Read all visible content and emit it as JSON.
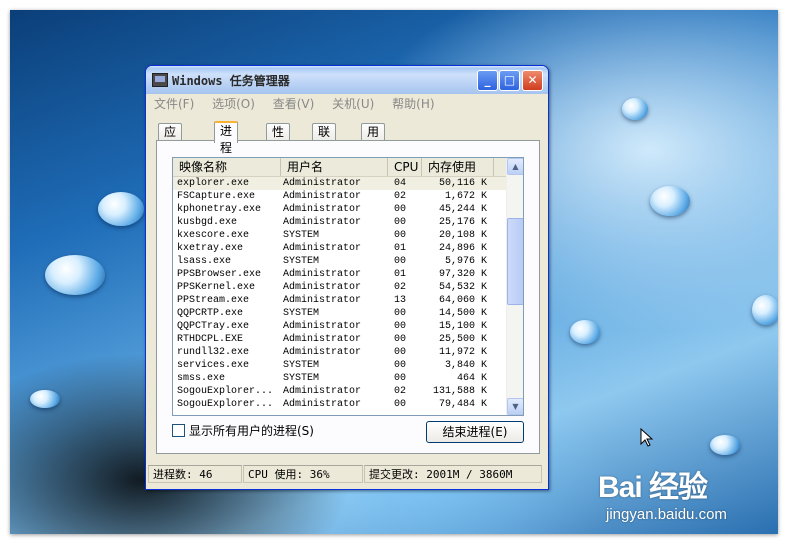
{
  "window": {
    "title": "Windows 任务管理器",
    "buttons": {
      "minimize": "_",
      "maximize": "□",
      "close": "✕"
    }
  },
  "menu": [
    "文件(F)",
    "选项(O)",
    "查看(V)",
    "关机(U)",
    "帮助(H)"
  ],
  "tabs": [
    "应用程序",
    "进程",
    "性能",
    "联网",
    "用户"
  ],
  "active_tab": "进程",
  "table": {
    "columns": [
      "映像名称",
      "用户名",
      "CPU",
      "内存使用"
    ],
    "rows": [
      [
        "explorer.exe",
        "Administrator",
        "04",
        "50,116 K"
      ],
      [
        "FSCapture.exe",
        "Administrator",
        "02",
        "1,672 K"
      ],
      [
        "kphonetray.exe",
        "Administrator",
        "00",
        "45,244 K"
      ],
      [
        "kusbgd.exe",
        "Administrator",
        "00",
        "25,176 K"
      ],
      [
        "kxescore.exe",
        "SYSTEM",
        "00",
        "20,108 K"
      ],
      [
        "kxetray.exe",
        "Administrator",
        "01",
        "24,896 K"
      ],
      [
        "lsass.exe",
        "SYSTEM",
        "00",
        "5,976 K"
      ],
      [
        "PPSBrowser.exe",
        "Administrator",
        "01",
        "97,320 K"
      ],
      [
        "PPSKernel.exe",
        "Administrator",
        "02",
        "54,532 K"
      ],
      [
        "PPStream.exe",
        "Administrator",
        "13",
        "64,060 K"
      ],
      [
        "QQPCRTP.exe",
        "SYSTEM",
        "00",
        "14,500 K"
      ],
      [
        "QQPCTray.exe",
        "Administrator",
        "00",
        "15,100 K"
      ],
      [
        "RTHDCPL.EXE",
        "Administrator",
        "00",
        "25,500 K"
      ],
      [
        "rundll32.exe",
        "Administrator",
        "00",
        "11,972 K"
      ],
      [
        "services.exe",
        "SYSTEM",
        "00",
        "3,840 K"
      ],
      [
        "smss.exe",
        "SYSTEM",
        "00",
        "464 K"
      ],
      [
        "SogouExplorer...",
        "Administrator",
        "02",
        "131,588 K"
      ],
      [
        "SogouExplorer...",
        "Administrator",
        "00",
        "79,484 K"
      ]
    ]
  },
  "show_all_users": "显示所有用户的进程(S)",
  "end_process": "结束进程(E)",
  "status": {
    "processes": "进程数: 46",
    "cpu": "CPU 使用: 36%",
    "commit": "提交更改: 2001M / 3860M"
  },
  "watermark": {
    "logo": "Bai 经验",
    "sub": "jingyan.baidu.com"
  }
}
